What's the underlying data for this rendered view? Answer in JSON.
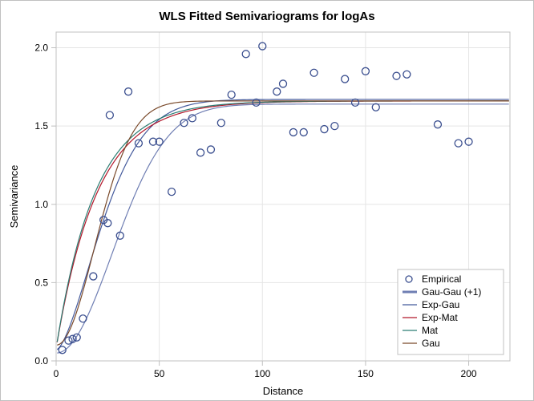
{
  "chart_data": {
    "type": "scatter",
    "title": "WLS Fitted Semivariograms for logAs",
    "xlabel": "Distance",
    "ylabel": "Semivariance",
    "xlim": [
      0,
      220
    ],
    "ylim": [
      0,
      2.1
    ],
    "xticks": [
      0,
      50,
      100,
      150,
      200
    ],
    "yticks": [
      0.0,
      0.5,
      1.0,
      1.5,
      2.0
    ],
    "legend": {
      "position": "bottom-right",
      "entries": [
        "Empirical",
        "Gau-Gau (+1)",
        "Exp-Gau",
        "Exp-Mat",
        "Mat",
        "Gau"
      ]
    },
    "empirical_points": [
      {
        "x": 3,
        "y": 0.07
      },
      {
        "x": 6,
        "y": 0.13
      },
      {
        "x": 8,
        "y": 0.14
      },
      {
        "x": 10,
        "y": 0.15
      },
      {
        "x": 13,
        "y": 0.27
      },
      {
        "x": 18,
        "y": 0.54
      },
      {
        "x": 23,
        "y": 0.9
      },
      {
        "x": 25,
        "y": 0.88
      },
      {
        "x": 26,
        "y": 1.57
      },
      {
        "x": 31,
        "y": 0.8
      },
      {
        "x": 35,
        "y": 1.72
      },
      {
        "x": 40,
        "y": 1.39
      },
      {
        "x": 47,
        "y": 1.4
      },
      {
        "x": 50,
        "y": 1.4
      },
      {
        "x": 56,
        "y": 1.08
      },
      {
        "x": 62,
        "y": 1.52
      },
      {
        "x": 66,
        "y": 1.55
      },
      {
        "x": 70,
        "y": 1.33
      },
      {
        "x": 75,
        "y": 1.35
      },
      {
        "x": 80,
        "y": 1.52
      },
      {
        "x": 85,
        "y": 1.7
      },
      {
        "x": 92,
        "y": 1.96
      },
      {
        "x": 97,
        "y": 1.65
      },
      {
        "x": 100,
        "y": 2.01
      },
      {
        "x": 107,
        "y": 1.72
      },
      {
        "x": 110,
        "y": 1.77
      },
      {
        "x": 115,
        "y": 1.46
      },
      {
        "x": 120,
        "y": 1.46
      },
      {
        "x": 125,
        "y": 1.84
      },
      {
        "x": 130,
        "y": 1.48
      },
      {
        "x": 135,
        "y": 1.5
      },
      {
        "x": 140,
        "y": 1.8
      },
      {
        "x": 145,
        "y": 1.65
      },
      {
        "x": 150,
        "y": 1.85
      },
      {
        "x": 155,
        "y": 1.62
      },
      {
        "x": 165,
        "y": 1.82
      },
      {
        "x": 170,
        "y": 1.83
      },
      {
        "x": 185,
        "y": 1.51
      },
      {
        "x": 195,
        "y": 1.39
      },
      {
        "x": 200,
        "y": 1.4
      }
    ],
    "series": [
      {
        "name": "Gau-Gau (+1)",
        "color": "#6F7EB3",
        "width": 3.0,
        "type": "gaussian",
        "nugget": 0.05,
        "sill": 1.64,
        "range": 38
      },
      {
        "name": "Exp-Gau",
        "color": "#445A9C",
        "width": 1.2,
        "type": "gau_like",
        "nugget": 0.07,
        "sill": 1.67,
        "range": 28
      },
      {
        "name": "Exp-Mat",
        "color": "#B2182B",
        "width": 1.2,
        "type": "exp",
        "nugget": 0.08,
        "sill": 1.66,
        "range": 20
      },
      {
        "name": "Mat",
        "color": "#2C7D73",
        "width": 1.2,
        "type": "exp",
        "nugget": 0.08,
        "sill": 1.66,
        "range": 19
      },
      {
        "name": "Gau",
        "color": "#7A4A2B",
        "width": 1.2,
        "type": "gaussian",
        "nugget": 0.1,
        "sill": 1.66,
        "range": 26
      }
    ]
  }
}
